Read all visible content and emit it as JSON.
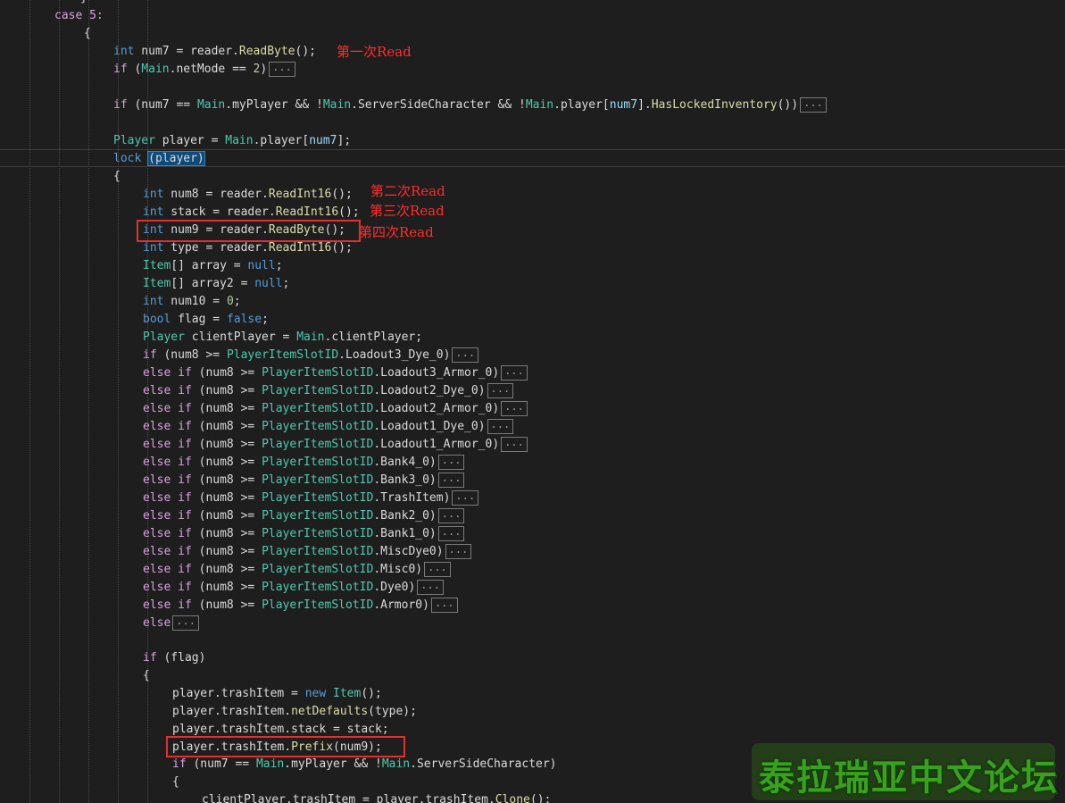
{
  "annotations": {
    "read1": "第一次Read",
    "read2": "第二次Read",
    "read3": "第三次Read",
    "read4": "第四次Read"
  },
  "watermark_text": "泰拉瑞亚中文论坛",
  "fold_marker": "...",
  "code": {
    "l0": "case 5:",
    "l1": "{",
    "int": "int",
    "if": "if",
    "else": "else",
    "l2_rest": " num7 = reader.",
    "l2_fn": "ReadByte",
    "l2_end": "();",
    "l3_a": " (",
    "l3_b": "Main",
    "l3_c": ".netMode == ",
    "l3_d": "2",
    "l3_e": ")",
    "l4_a": " (num7 == ",
    "l4_b": "Main",
    "l4_c": ".myPlayer && !",
    "l4_d": "Main",
    "l4_e": ".ServerSideCharacter && !",
    "l4_f": "Main",
    "l4_g": ".player[",
    "l4_h": "num7",
    "l4_i": "].",
    "l4_j": "HasLockedInventory",
    "l4_k": "())",
    "l5_a": "Player",
    "l5_b": " player = ",
    "l5_c": "Main",
    "l5_d": ".player[",
    "l5_e": "num7",
    "l5_f": "];",
    "lock": "lock",
    "l6_b": " ",
    "l6_c": "(player)",
    "l7": "{",
    "l8_rest": " num8 = reader.",
    "l8_fn": "ReadInt16",
    "l8_end": "();",
    "l9_rest": " stack = reader.",
    "l9_fn": "ReadInt16",
    "l9_end": "();",
    "l10_rest": " num9 = reader.",
    "l10_fn": "ReadByte",
    "l10_end": "();",
    "l11_rest": " type = reader.",
    "l11_fn": "ReadInt16",
    "l11_end": "();",
    "item": "Item",
    "l12_rest": "[] array = ",
    "null": "null",
    "semi": ";",
    "l13_rest": "[] array2 = ",
    "l14_rest": " num10 = ",
    "zero": "0",
    "bool": "bool",
    "l15_rest": " flag = ",
    "false": "false",
    "player_t": "Player",
    "l16_rest": " clientPlayer = ",
    "main": "Main",
    "l16_end": ".clientPlayer;",
    "slot_cls": "PlayerItemSlotID",
    "cond_pre": " (num8 >= ",
    "slots": [
      ".Loadout3_Dye_0)",
      ".Loadout3_Armor_0)",
      ".Loadout2_Dye_0)",
      ".Loadout2_Armor_0)",
      ".Loadout1_Dye_0)",
      ".Loadout1_Armor_0)",
      ".Bank4_0)",
      ".Bank3_0)",
      ".TrashItem)",
      ".Bank2_0)",
      ".Bank1_0)",
      ".MiscDye0)",
      ".Misc0)",
      ".Dye0)",
      ".Armor0)"
    ],
    "l33_b": " (flag)",
    "l34": "{",
    "l35_a": "player.trashItem = ",
    "new": "new",
    "l35_c": " ",
    "l35_e": "();",
    "l36_a": "player.trashItem.",
    "l36_fn": "netDefaults",
    "l36_end": "(type);",
    "l37": "player.trashItem.stack = stack;",
    "l38_a": "player.trashItem.",
    "l38_fn": "Prefix",
    "l38_end": "(num9);",
    "l39_a": " (num7 == ",
    "l39_c": ".myPlayer && !",
    "l39_e": ".ServerSideCharacter)",
    "l40": "{",
    "l41_a": "clientPlayer.trashItem = player.trashItem.",
    "l41_fn": "Clone",
    "l41_end": "();"
  }
}
